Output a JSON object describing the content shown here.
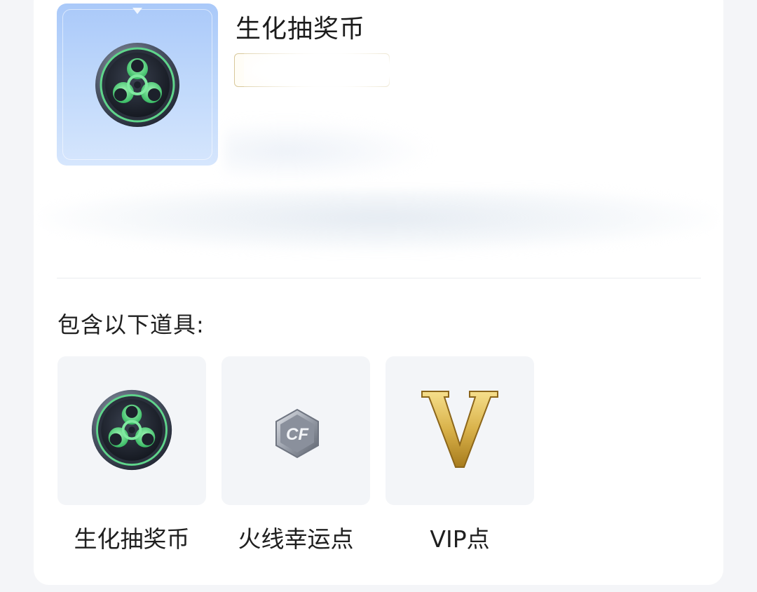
{
  "product": {
    "title": "生化抽奖币",
    "icon": "biohazard-coin-icon",
    "hero_gradient": [
      "#aac9f9",
      "#d6e6fd"
    ]
  },
  "section": {
    "label": "包含以下道具:"
  },
  "items": [
    {
      "label": "生化抽奖币",
      "icon": "biohazard-coin-icon"
    },
    {
      "label": "火线幸运点",
      "icon": "cf-lucky-point-icon"
    },
    {
      "label": "VIP点",
      "icon": "vip-v-icon"
    }
  ],
  "colors": {
    "accent_green": "#4fd07a",
    "gold": "#d9b24a",
    "tag_border": "#d8c89a"
  }
}
